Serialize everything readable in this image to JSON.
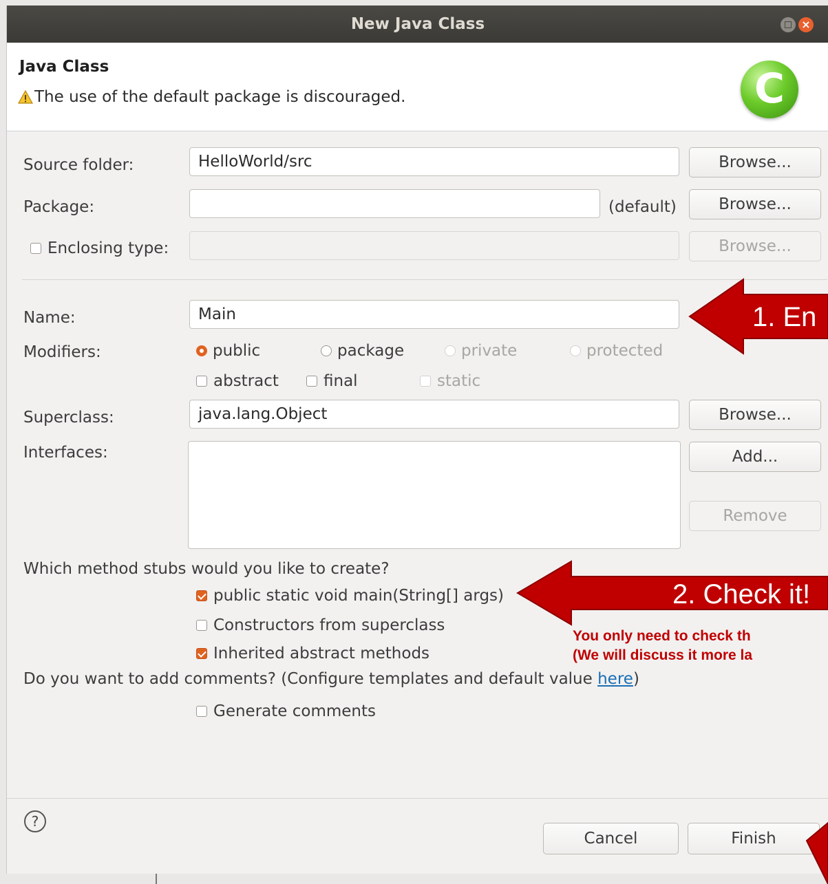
{
  "dialog": {
    "title": "New Java Class",
    "close_glyph": "×"
  },
  "header": {
    "title": "Java Class",
    "message": "The use of the default package is discouraged.",
    "icon_letter": "C"
  },
  "form": {
    "source_folder_label": "Source folder:",
    "source_folder_value": "HelloWorld/src",
    "package_label": "Package:",
    "package_value": "",
    "package_default": "(default)",
    "enclosing_type_label": "Enclosing type:",
    "enclosing_type_value": "",
    "name_label": "Name:",
    "name_value": "Main",
    "modifiers_label": "Modifiers:",
    "modifiers": {
      "public": "public",
      "package": "package",
      "private": "private",
      "protected": "protected",
      "abstract": "abstract",
      "final": "final",
      "static": "static"
    },
    "superclass_label": "Superclass:",
    "superclass_value": "java.lang.Object",
    "interfaces_label": "Interfaces:",
    "browse_label": "Browse...",
    "add_label": "Add...",
    "remove_label": "Remove",
    "stubs_question": "Which method stubs would you like to create?",
    "stub_main": "public static void main(String[] args)",
    "stub_constructors": "Constructors from superclass",
    "stub_inherited": "Inherited abstract methods",
    "comments_question": "Do you want to add comments? (Configure templates and default value ",
    "comments_link": "here",
    "comments_close": ")",
    "generate_comments": "Generate comments"
  },
  "footer": {
    "help_glyph": "?",
    "cancel_label": "Cancel",
    "finish_label": "Finish"
  },
  "annotations": {
    "step1": "1. En",
    "step2": "2. Check it!",
    "note_line1": "You only need to check th",
    "note_line2": "(We will discuss it more la"
  },
  "colors": {
    "accent": "#e0621f",
    "annotation_red": "#c00000",
    "titlebar": "#3b3a36"
  }
}
